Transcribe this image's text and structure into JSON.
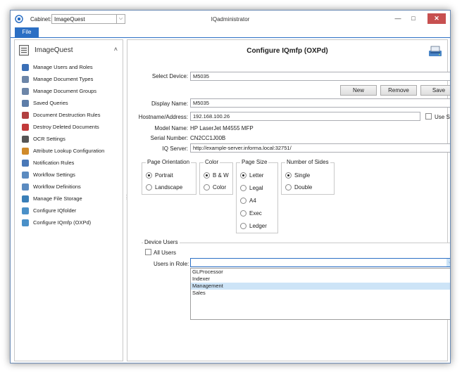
{
  "window": {
    "title": "IQadministrator",
    "cabinet_label": "Cabinet:",
    "cabinet_value": "ImageQuest",
    "minimize": "—",
    "maximize": "□",
    "close": "✕"
  },
  "menu": {
    "file": "File"
  },
  "sidebar": {
    "header": "ImageQuest",
    "collapse_glyph": "˄",
    "items": [
      {
        "label": "Manage Users and Roles",
        "icon": "users-icon",
        "color": "#3b6fb6"
      },
      {
        "label": "Manage Document Types",
        "icon": "document-types-icon",
        "color": "#6d86a8"
      },
      {
        "label": "Manage Document Groups",
        "icon": "document-groups-icon",
        "color": "#6d86a8"
      },
      {
        "label": "Saved Queries",
        "icon": "saved-queries-icon",
        "color": "#5d7da8"
      },
      {
        "label": "Document Destruction Rules",
        "icon": "destruction-rules-icon",
        "color": "#b24040"
      },
      {
        "label": "Destroy Deleted Documents",
        "icon": "destroy-icon",
        "color": "#c23a3a"
      },
      {
        "label": "OCR Settings",
        "icon": "ocr-icon",
        "color": "#555555"
      },
      {
        "label": "Attribute Lookup Configuration",
        "icon": "lookup-icon",
        "color": "#d08a2a"
      },
      {
        "label": "Notification Rules",
        "icon": "notification-icon",
        "color": "#4a79b8"
      },
      {
        "label": "Workflow Settings",
        "icon": "workflow-settings-icon",
        "color": "#5b8bc0"
      },
      {
        "label": "Workflow Definitions",
        "icon": "workflow-definitions-icon",
        "color": "#5b8bc0"
      },
      {
        "label": "Manage File Storage",
        "icon": "file-storage-icon",
        "color": "#3a7fb8"
      },
      {
        "label": "Configure IQfolder",
        "icon": "iqfolder-icon",
        "color": "#4a90c8"
      },
      {
        "label": "Configure IQmfp (OXPd)",
        "icon": "iqmfp-icon",
        "color": "#4a90c8"
      }
    ]
  },
  "main": {
    "title": "Configure IQmfp (OXPd)",
    "select_device_label": "Select Device:",
    "select_device_value": "M5035",
    "buttons": {
      "new": "New",
      "remove": "Remove",
      "save": "Save"
    },
    "display_name_label": "Display Name:",
    "display_name_value": "M5035",
    "hostname_label": "Hostname/Address:",
    "hostname_value": "192.168.100.26",
    "use_ssl_label": "Use SSL",
    "model_name_label": "Model Name:",
    "model_name_value": "HP LaserJet M4555 MFP",
    "serial_number_label": "Serial Number:",
    "serial_number_value": "CN2CC1J00B",
    "iq_server_label": "IQ Server:",
    "iq_server_value": "http://example-server.informa.local:32751/",
    "page_orientation": {
      "title": "Page Orientation",
      "options": [
        "Portrait",
        "Landscape"
      ],
      "selected": "Portrait"
    },
    "color": {
      "title": "Color",
      "options": [
        "B & W",
        "Color"
      ],
      "selected": "B & W"
    },
    "page_size": {
      "title": "Page Size",
      "options": [
        "Letter",
        "Legal",
        "A4",
        "Exec",
        "Ledger"
      ],
      "selected": "Letter"
    },
    "number_of_sides": {
      "title": "Number of Sides",
      "options": [
        "Single",
        "Double"
      ],
      "selected": "Single"
    },
    "device_users": {
      "title": "Device Users",
      "all_users_label": "All Users",
      "users_in_role_label": "Users in Role:",
      "users_in_role_value": "",
      "role_options": [
        "GLProcessor",
        "Indexer",
        "Management",
        "Sales"
      ],
      "highlighted_option": "Management"
    }
  }
}
